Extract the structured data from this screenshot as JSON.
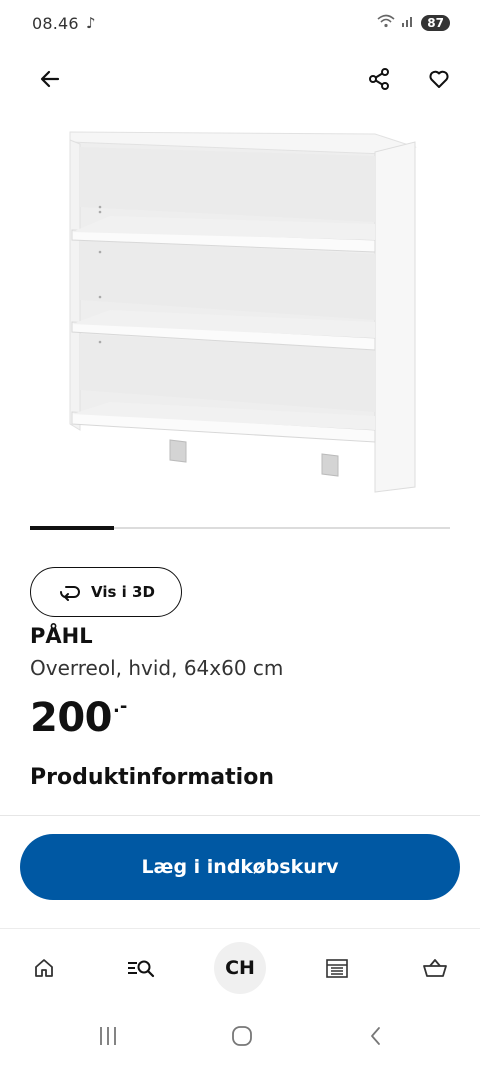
{
  "status_bar": {
    "time": "08.46",
    "dnd_glyph": "♪",
    "battery": "87",
    "icons": [
      "wifi-icon",
      "signal-icon",
      "battery-icon"
    ]
  },
  "top_bar": {
    "icons": [
      "arrow-left-icon",
      "share-icon",
      "heart-icon"
    ]
  },
  "carousel": {
    "progress": 0.2
  },
  "view3d": {
    "label": "Vis i 3D",
    "icon": "rotate-3d-icon"
  },
  "product": {
    "name": "PÅHL",
    "description": "Overreol, hvid, 64x60 cm",
    "price": "200",
    "price_suffix": ".-"
  },
  "section": {
    "heading": "Produktinformation"
  },
  "cta": {
    "label": "Læg i indkøbskurv",
    "color": "#0058a3"
  },
  "bottom_nav": {
    "account_label": "CH",
    "icons": [
      "home-icon",
      "search-list-icon",
      "account-avatar",
      "store-icon",
      "basket-icon"
    ]
  },
  "system_nav": {
    "icons": [
      "recents-icon",
      "home-circle-icon",
      "back-chevron-icon"
    ]
  }
}
